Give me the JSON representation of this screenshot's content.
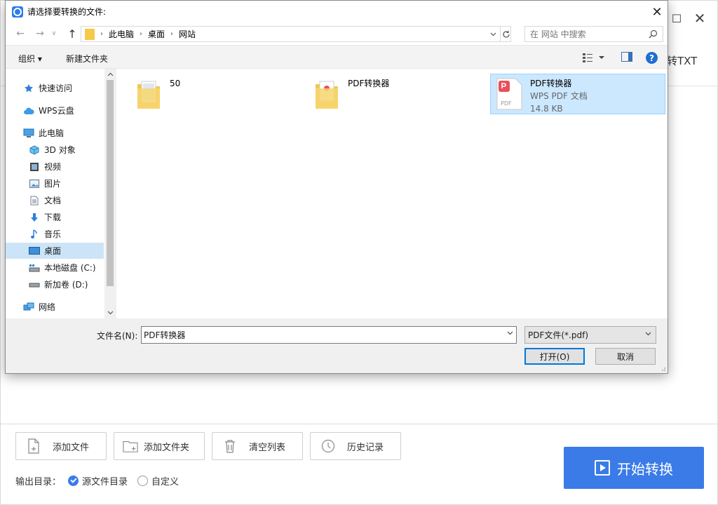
{
  "background_app": {
    "tab_partial": "转TXT",
    "maximize_glyph": "☐",
    "close_glyph": "✕",
    "toolbar": [
      {
        "label": "添加文件",
        "icon": "add-file-icon"
      },
      {
        "label": "添加文件夹",
        "icon": "add-folder-icon"
      },
      {
        "label": "清空列表",
        "icon": "trash-icon"
      },
      {
        "label": "历史记录",
        "icon": "clock-icon"
      }
    ],
    "output_dir_label": "输出目录：",
    "output_options": [
      {
        "label": "源文件目录",
        "checked": true
      },
      {
        "label": "自定义",
        "checked": false
      }
    ],
    "start_button": "开始转换",
    "accent_color": "#3a7be8"
  },
  "dialog": {
    "title": "请选择要转换的文件:",
    "close_glyph": "✕",
    "nav": {
      "back": "←",
      "forward": "→",
      "recent": "∨",
      "up": "↑"
    },
    "breadcrumb": [
      "此电脑",
      "桌面",
      "网站"
    ],
    "breadcrumb_sep": "›",
    "search_placeholder": "在 网站 中搜索",
    "toolbar": {
      "organize": "组织 ▾",
      "new_folder": "新建文件夹",
      "help": "?"
    },
    "sidebar": [
      {
        "label": "快速访问",
        "icon": "star-icon",
        "indent": 0
      },
      {
        "label": "WPS云盘",
        "icon": "cloud-icon",
        "indent": 0
      },
      {
        "label": "此电脑",
        "icon": "computer-icon",
        "indent": 0
      },
      {
        "label": "3D 对象",
        "icon": "cube-icon",
        "indent": 1
      },
      {
        "label": "视频",
        "icon": "film-icon",
        "indent": 1
      },
      {
        "label": "图片",
        "icon": "picture-icon",
        "indent": 1
      },
      {
        "label": "文档",
        "icon": "document-icon",
        "indent": 1
      },
      {
        "label": "下载",
        "icon": "download-icon",
        "indent": 1
      },
      {
        "label": "音乐",
        "icon": "music-icon",
        "indent": 1
      },
      {
        "label": "桌面",
        "icon": "desktop-icon",
        "indent": 1,
        "selected": true
      },
      {
        "label": "本地磁盘 (C:)",
        "icon": "drive-c-icon",
        "indent": 1
      },
      {
        "label": "新加卷 (D:)",
        "icon": "drive-d-icon",
        "indent": 1
      },
      {
        "label": "网络",
        "icon": "network-icon",
        "indent": 0
      }
    ],
    "files": [
      {
        "name": "50",
        "type": "folder"
      },
      {
        "name": "PDF转换器",
        "type": "folder"
      },
      {
        "name": "PDF转换器",
        "type": "pdf",
        "subtitle": "WPS PDF 文档",
        "size": "14.8 KB",
        "selected": true
      }
    ],
    "filename_label": "文件名(N):",
    "filename_value": "PDF转换器",
    "filetype_value": "PDF文件(*.pdf)",
    "open_button": "打开(O)",
    "cancel_button": "取消"
  }
}
